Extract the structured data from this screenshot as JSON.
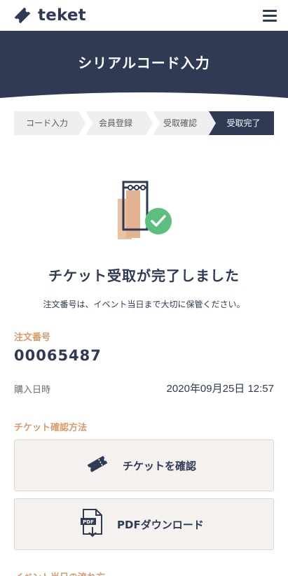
{
  "header": {
    "logo_text": "teket",
    "menu_icon": "hamburger-menu-icon"
  },
  "banner": {
    "title": "シリアルコード入力"
  },
  "steps": [
    {
      "label": "コード入力",
      "active": false
    },
    {
      "label": "会員登録",
      "active": false
    },
    {
      "label": "受取確認",
      "active": false
    },
    {
      "label": "受取完了",
      "active": true
    }
  ],
  "result": {
    "icon": "ticket-check-icon",
    "title": "チケット受取が完了しました",
    "subtitle": "注文番号は、イベント当日まで大切に保管ください。"
  },
  "order": {
    "label": "注文番号",
    "number": "00065487"
  },
  "purchase": {
    "label": "購入日時",
    "value": "2020年09月25日 12:57"
  },
  "methods": {
    "label": "チケット確認方法",
    "view_ticket": {
      "label": "チケットを確認",
      "icon": "ticket-icon"
    },
    "pdf_download": {
      "label": "PDFダウンロード",
      "icon": "pdf-download-icon"
    }
  },
  "bottom_section": {
    "label": "イベント当日の流れ方"
  },
  "colors": {
    "navy": "#2f3a55",
    "accent": "#d99a6c",
    "step_bg": "#f0efef",
    "button_bg": "#f5f1ef",
    "success_green": "#5cbf7e"
  }
}
